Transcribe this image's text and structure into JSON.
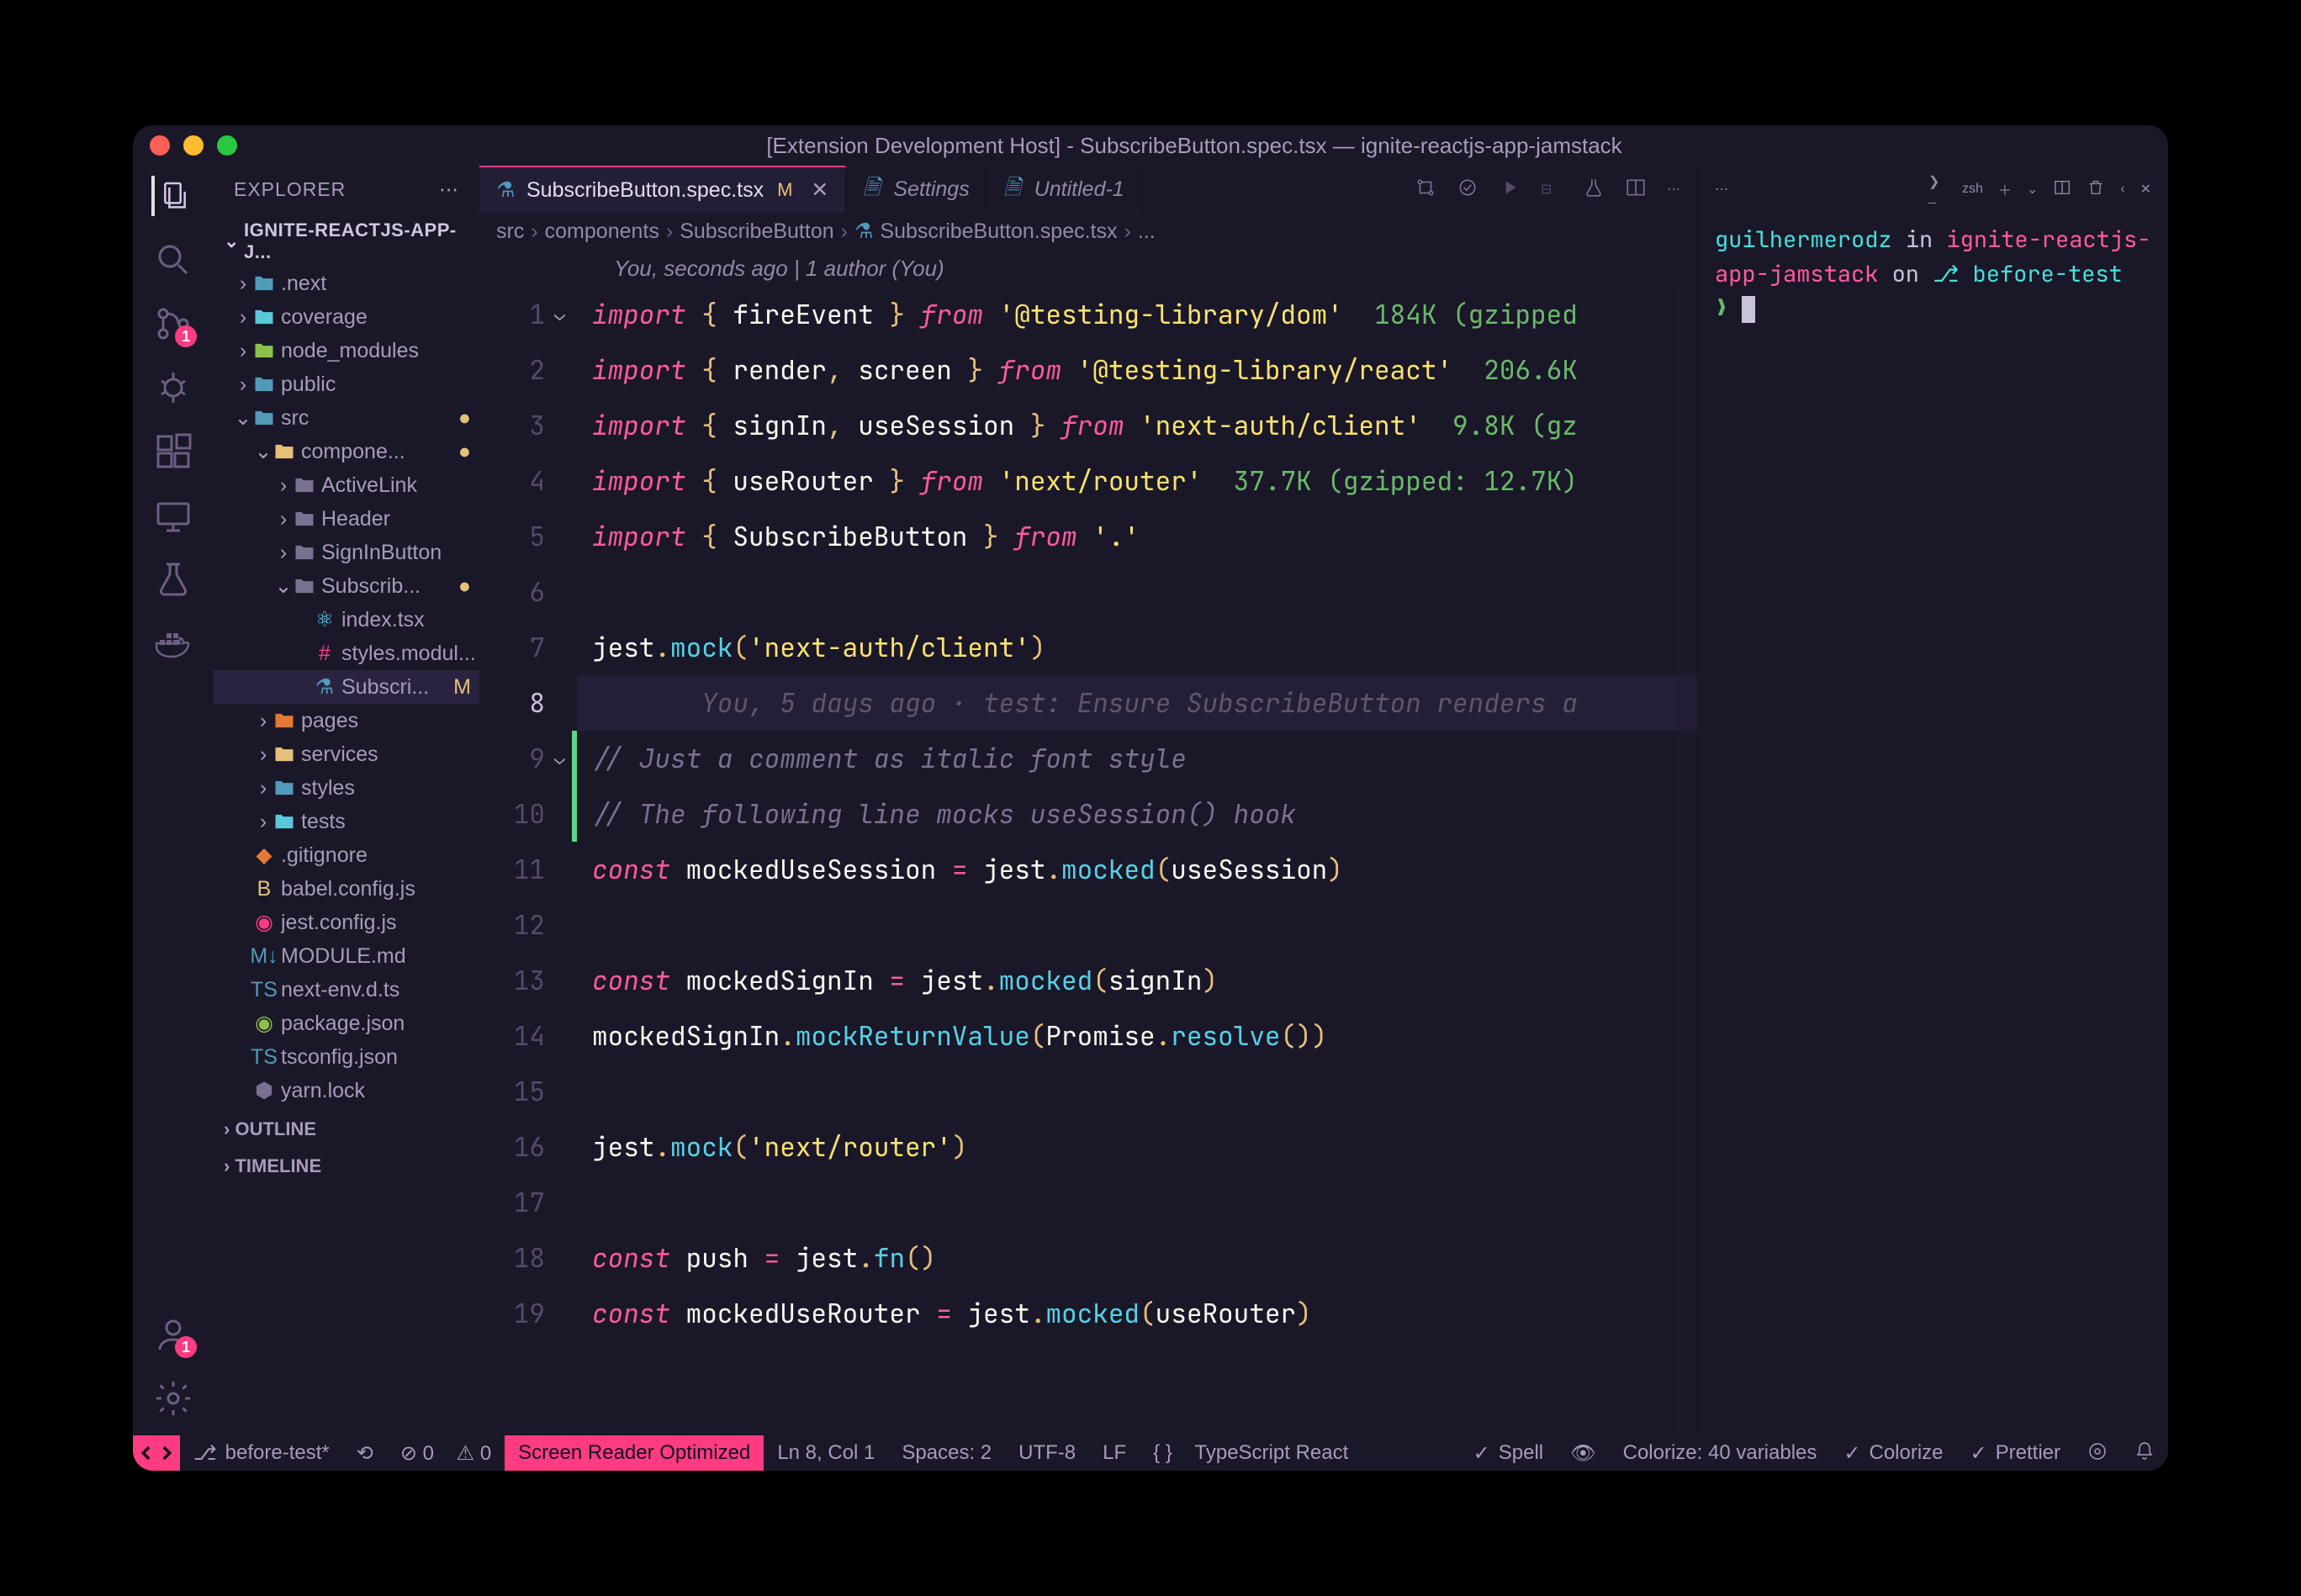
{
  "title": "[Extension Development Host] - SubscribeButton.spec.tsx — ignite-reactjs-app-jamstack",
  "explorer": {
    "header": "EXPLORER",
    "project": "IGNITE-REACTJS-APP-J..."
  },
  "outline": "OUTLINE",
  "timeline": "TIMELINE",
  "tree": [
    {
      "d": 1,
      "t": "folder",
      "open": false,
      "label": ".next",
      "ic": "fc-blue"
    },
    {
      "d": 1,
      "t": "folder",
      "open": false,
      "label": "coverage",
      "ic": "fc-teal"
    },
    {
      "d": 1,
      "t": "folder",
      "open": false,
      "label": "node_modules",
      "ic": "fc-green"
    },
    {
      "d": 1,
      "t": "folder",
      "open": false,
      "label": "public",
      "ic": "fc-blue"
    },
    {
      "d": 1,
      "t": "folder",
      "open": true,
      "label": "src",
      "ic": "fc-blue",
      "mod": "●"
    },
    {
      "d": 2,
      "t": "folder",
      "open": true,
      "label": "compone...",
      "ic": "fc-yellow",
      "mod": "●"
    },
    {
      "d": 3,
      "t": "folder",
      "open": false,
      "label": "ActiveLink",
      "ic": "fc-gray"
    },
    {
      "d": 3,
      "t": "folder",
      "open": false,
      "label": "Header",
      "ic": "fc-gray"
    },
    {
      "d": 3,
      "t": "folder",
      "open": false,
      "label": "SignInButton",
      "ic": "fc-gray"
    },
    {
      "d": 3,
      "t": "folder",
      "open": true,
      "label": "Subscrib...",
      "ic": "fc-gray",
      "mod": "●"
    },
    {
      "d": 4,
      "t": "file",
      "label": "index.tsx",
      "ic": "fc-react",
      "glyph": "⚛"
    },
    {
      "d": 4,
      "t": "file",
      "label": "styles.modul...",
      "ic": "fc-pink",
      "glyph": "#"
    },
    {
      "d": 4,
      "t": "file",
      "label": "Subscri...",
      "ic": "fc-blue",
      "glyph": "⚗",
      "mod": "M",
      "sel": true
    },
    {
      "d": 2,
      "t": "folder",
      "open": false,
      "label": "pages",
      "ic": "fc-orange"
    },
    {
      "d": 2,
      "t": "folder",
      "open": false,
      "label": "services",
      "ic": "fc-yellow"
    },
    {
      "d": 2,
      "t": "folder",
      "open": false,
      "label": "styles",
      "ic": "fc-blue"
    },
    {
      "d": 2,
      "t": "folder",
      "open": false,
      "label": "tests",
      "ic": "fc-teal"
    },
    {
      "d": 1,
      "t": "file",
      "label": ".gitignore",
      "ic": "fc-orange",
      "glyph": "◆"
    },
    {
      "d": 1,
      "t": "file",
      "label": "babel.config.js",
      "ic": "fc-yellow",
      "glyph": "B"
    },
    {
      "d": 1,
      "t": "file",
      "label": "jest.config.js",
      "ic": "fc-pink",
      "glyph": "◉"
    },
    {
      "d": 1,
      "t": "file",
      "label": "MODULE.md",
      "ic": "fc-blue",
      "glyph": "M↓"
    },
    {
      "d": 1,
      "t": "file",
      "label": "next-env.d.ts",
      "ic": "fc-blue",
      "glyph": "TS"
    },
    {
      "d": 1,
      "t": "file",
      "label": "package.json",
      "ic": "fc-green",
      "glyph": "◉"
    },
    {
      "d": 1,
      "t": "file",
      "label": "tsconfig.json",
      "ic": "fc-blue",
      "glyph": "TS"
    },
    {
      "d": 1,
      "t": "file",
      "label": "yarn.lock",
      "ic": "fc-gray",
      "glyph": "⬢"
    }
  ],
  "tabs": [
    {
      "label": "SubscribeButton.spec.tsx",
      "active": true,
      "mod": "M",
      "icon": "⚗",
      "ic": "fc-blue"
    },
    {
      "label": "Settings",
      "icon": "🗎",
      "ic": "fc-blue"
    },
    {
      "label": "Untitled-1",
      "icon": "🗎",
      "ic": "fc-blue"
    }
  ],
  "breadcrumb": [
    "src",
    "components",
    "SubscribeButton",
    "SubscribeButton.spec.tsx",
    "..."
  ],
  "bcIcon": "⚗",
  "codelens": "You, seconds ago | 1 author (You)",
  "code": [
    {
      "n": 1,
      "fold": true,
      "seg": [
        [
          "imp",
          "import "
        ],
        [
          "pn",
          "{ "
        ],
        [
          "id",
          "fireEvent"
        ],
        [
          "pn",
          " } "
        ],
        [
          "imp",
          "from "
        ],
        [
          "str",
          "'@testing-library/dom'"
        ],
        [
          "id",
          "  "
        ],
        [
          "siz",
          "184K (gzipped"
        ]
      ]
    },
    {
      "n": 2,
      "seg": [
        [
          "imp",
          "import "
        ],
        [
          "pn",
          "{ "
        ],
        [
          "id",
          "render"
        ],
        [
          "pn",
          ", "
        ],
        [
          "id",
          "screen"
        ],
        [
          "pn",
          " } "
        ],
        [
          "imp",
          "from "
        ],
        [
          "str",
          "'@testing-library/react'"
        ],
        [
          "id",
          "  "
        ],
        [
          "siz",
          "206.6K"
        ]
      ]
    },
    {
      "n": 3,
      "seg": [
        [
          "imp",
          "import "
        ],
        [
          "pn",
          "{ "
        ],
        [
          "id",
          "signIn"
        ],
        [
          "pn",
          ", "
        ],
        [
          "id",
          "useSession"
        ],
        [
          "pn",
          " } "
        ],
        [
          "imp",
          "from "
        ],
        [
          "str",
          "'next-auth/client'"
        ],
        [
          "id",
          "  "
        ],
        [
          "siz",
          "9.8K (gz"
        ]
      ]
    },
    {
      "n": 4,
      "seg": [
        [
          "imp",
          "import "
        ],
        [
          "pn",
          "{ "
        ],
        [
          "id",
          "useRouter"
        ],
        [
          "pn",
          " } "
        ],
        [
          "imp",
          "from "
        ],
        [
          "str",
          "'next/router'"
        ],
        [
          "id",
          "  "
        ],
        [
          "siz",
          "37.7K (gzipped: 12.7K)"
        ]
      ]
    },
    {
      "n": 5,
      "seg": [
        [
          "imp",
          "import "
        ],
        [
          "pn",
          "{ "
        ],
        [
          "id",
          "SubscribeButton"
        ],
        [
          "pn",
          " } "
        ],
        [
          "imp",
          "from "
        ],
        [
          "str",
          "'.'"
        ]
      ]
    },
    {
      "n": 6,
      "seg": []
    },
    {
      "n": 7,
      "seg": [
        [
          "id",
          "jest"
        ],
        [
          "pn",
          "."
        ],
        [
          "fn",
          "mock"
        ],
        [
          "pn",
          "("
        ],
        [
          "str",
          "'next-auth/client'"
        ],
        [
          "pn",
          ")"
        ]
      ]
    },
    {
      "n": 8,
      "hl": true,
      "seg": [
        [
          "blame",
          "       You, 5 days ago · test: Ensure SubscribeButton renders a"
        ]
      ]
    },
    {
      "n": 9,
      "git": "add",
      "fold": true,
      "seg": [
        [
          "cmt",
          "// Just a comment as italic font style"
        ]
      ]
    },
    {
      "n": 10,
      "git": "add",
      "seg": [
        [
          "cmt",
          "// The following line mocks useSession() hook"
        ]
      ]
    },
    {
      "n": 11,
      "seg": [
        [
          "kw",
          "const "
        ],
        [
          "id",
          "mockedUseSession"
        ],
        [
          "op",
          " = "
        ],
        [
          "id",
          "jest"
        ],
        [
          "pn",
          "."
        ],
        [
          "fn",
          "mocked"
        ],
        [
          "pn",
          "("
        ],
        [
          "id",
          "useSession"
        ],
        [
          "pn",
          ")"
        ]
      ]
    },
    {
      "n": 12,
      "seg": []
    },
    {
      "n": 13,
      "seg": [
        [
          "kw",
          "const "
        ],
        [
          "id",
          "mockedSignIn"
        ],
        [
          "op",
          " = "
        ],
        [
          "id",
          "jest"
        ],
        [
          "pn",
          "."
        ],
        [
          "fn",
          "mocked"
        ],
        [
          "pn",
          "("
        ],
        [
          "id",
          "signIn"
        ],
        [
          "pn",
          ")"
        ]
      ]
    },
    {
      "n": 14,
      "seg": [
        [
          "id",
          "mockedSignIn"
        ],
        [
          "pn",
          "."
        ],
        [
          "fn",
          "mockReturnValue"
        ],
        [
          "pn",
          "("
        ],
        [
          "id",
          "Promise"
        ],
        [
          "pn",
          "."
        ],
        [
          "fn",
          "resolve"
        ],
        [
          "pn",
          "())"
        ]
      ]
    },
    {
      "n": 15,
      "seg": []
    },
    {
      "n": 16,
      "seg": [
        [
          "id",
          "jest"
        ],
        [
          "pn",
          "."
        ],
        [
          "fn",
          "mock"
        ],
        [
          "pn",
          "("
        ],
        [
          "str",
          "'next/router'"
        ],
        [
          "pn",
          ")"
        ]
      ]
    },
    {
      "n": 17,
      "seg": []
    },
    {
      "n": 18,
      "seg": [
        [
          "kw",
          "const "
        ],
        [
          "id",
          "push"
        ],
        [
          "op",
          " = "
        ],
        [
          "id",
          "jest"
        ],
        [
          "pn",
          "."
        ],
        [
          "fn",
          "fn"
        ],
        [
          "pn",
          "()"
        ]
      ]
    },
    {
      "n": 19,
      "seg": [
        [
          "kw",
          "const "
        ],
        [
          "id",
          "mockedUseRouter"
        ],
        [
          "op",
          " = "
        ],
        [
          "id",
          "jest"
        ],
        [
          "pn",
          "."
        ],
        [
          "fn",
          "mocked"
        ],
        [
          "pn",
          "("
        ],
        [
          "id",
          "useRouter"
        ],
        [
          "pn",
          ")"
        ]
      ]
    }
  ],
  "terminal": {
    "shell": "zsh",
    "user": "guilhermerodz",
    "in": "in",
    "repo": "ignite-reactjs-app-jamstack",
    "on": "on",
    "branch": "before-test",
    "prompt": "❯"
  },
  "status": {
    "branch": "before-test*",
    "sync": "⟲",
    "err": "⊘ 0",
    "warn": "⚠ 0",
    "reader": "Screen Reader Optimized",
    "pos": "Ln 8, Col 1",
    "spaces": "Spaces: 2",
    "enc": "UTF-8",
    "eol": "LF",
    "lang": "TypeScript React",
    "spell": "Spell",
    "colorize": "Colorize: 40 variables",
    "colorize2": "Colorize",
    "prettier": "Prettier"
  },
  "badges": {
    "scm": "1",
    "acct": "1"
  }
}
